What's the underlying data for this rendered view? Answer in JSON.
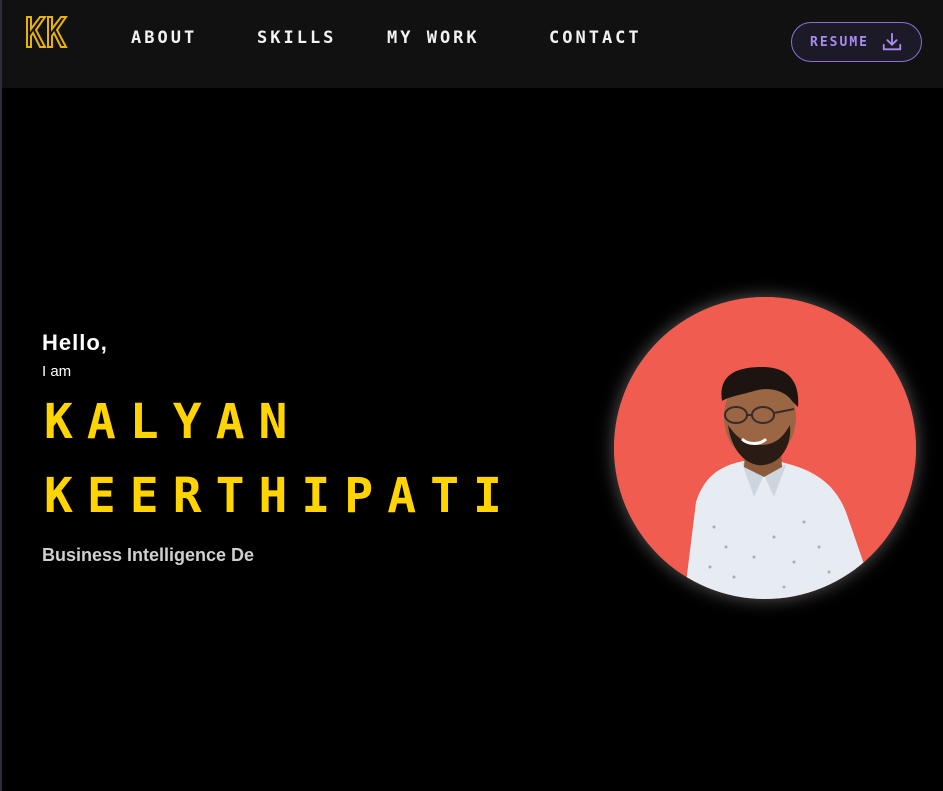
{
  "header": {
    "logo_text": "KK",
    "nav": [
      {
        "label": "ABOUT"
      },
      {
        "label": "SKILLS"
      },
      {
        "label": "MY WORK"
      },
      {
        "label": "CONTACT"
      }
    ],
    "resume_label": "RESUME",
    "resume_icon": "download-icon"
  },
  "hero": {
    "greeting": "Hello,",
    "intro": "I am",
    "name_first": "KALYAN",
    "name_last": "KEERTHIPATI",
    "role": "Business Intelligence De"
  },
  "colors": {
    "background": "#000000",
    "header_bg": "#111112",
    "accent_yellow": "#ffd400",
    "accent_purple": "#a98af0",
    "avatar_bg": "#f05c4f"
  }
}
